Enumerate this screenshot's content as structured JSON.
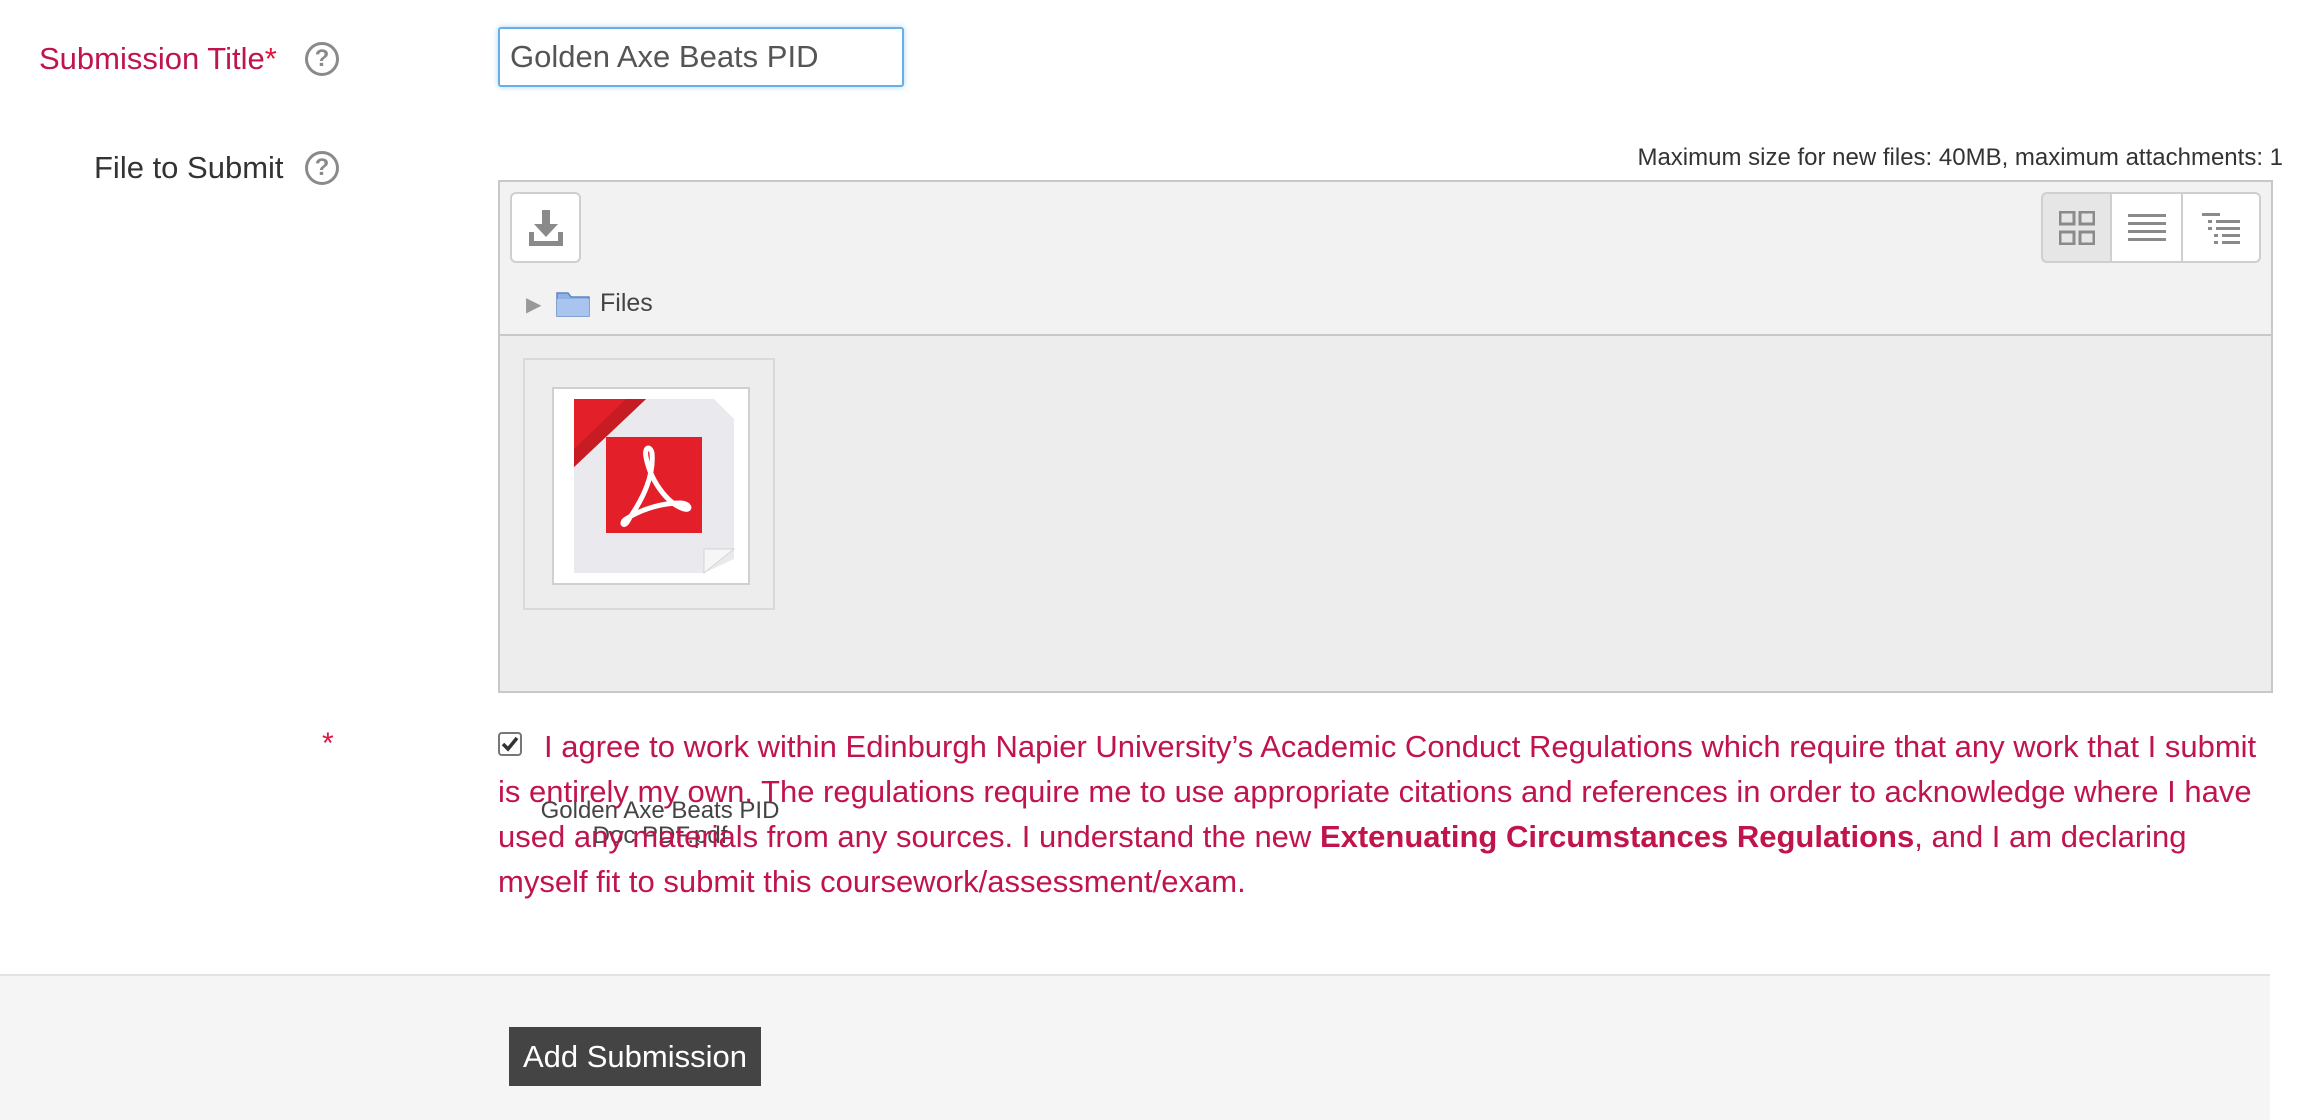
{
  "form": {
    "title_label": "Submission Title",
    "title_required_mark": "*",
    "title_value": "Golden Axe Beats PID",
    "file_label": "File to Submit",
    "help_glyph": "?"
  },
  "filepicker": {
    "limits_text": "Maximum size for new files: 40MB, maximum attachments: 1",
    "path_label": "Files",
    "file": {
      "name_line1": "Golden Axe Beats PID",
      "name_line2": "Doc PDF.pdf",
      "icon": "pdf-file-icon"
    },
    "view_buttons": [
      "icons-view-icon",
      "list-view-icon",
      "tree-view-icon"
    ]
  },
  "agreement": {
    "required_mark": "*",
    "checked": true,
    "text_before": "I agree to work within Edinburgh Napier University’s Academic Conduct Regulations which require that any work that I submit is entirely my own. The regulations require me to use appropriate citations and references in order to acknowledge where I have used any materials from any sources. I understand the new ",
    "link_text": "Extenuating Circumstances Regulations",
    "text_after": ", and I am declaring myself fit to submit this coursework/assessment/exam."
  },
  "footer": {
    "submit_label": "Add Submission"
  },
  "colors": {
    "required_red": "#e4133b",
    "label_accent": "#c0144c",
    "focus_blue": "#66afe9",
    "button_dark": "#444444"
  }
}
